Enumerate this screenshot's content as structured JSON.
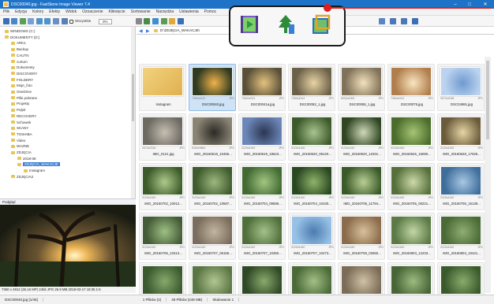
{
  "window": {
    "title": "DSC00040.jpg - FastStone Image Viewer 7.4",
    "min": "–",
    "max": "□",
    "close": "✕"
  },
  "menu": [
    "Plik",
    "Edycja",
    "Kolory",
    "Efekty",
    "Widok",
    "Oznaczenie",
    "Kliknięcie",
    "Sortowanie",
    "Narzędzia",
    "Ustawienia",
    "Pomoc"
  ],
  "toolbar": {
    "fit_label": "Wszystkie",
    "zoom": "0%",
    "sort_select": "Okrzycia & Miniatura",
    "size_select": "Nazwa"
  },
  "callout_icons": [
    "slideshow-film-icon",
    "tree-sort-icon",
    "crop-icon"
  ],
  "tree": [
    {
      "label": "WINDOWS (C:)",
      "depth": 0
    },
    {
      "label": "DOKUMENTY (D:)",
      "depth": 0
    },
    {
      "label": "ARK1",
      "depth": 1
    },
    {
      "label": "Backup",
      "depth": 1
    },
    {
      "label": "CAUTN",
      "depth": 1
    },
    {
      "label": "curtum",
      "depth": 1
    },
    {
      "label": "Dokumenty",
      "depth": 1
    },
    {
      "label": "DISCOVERY",
      "depth": 1
    },
    {
      "label": "FOLDERY",
      "depth": 1
    },
    {
      "label": "Moje_foto",
      "depth": 1
    },
    {
      "label": "OneDrive",
      "depth": 1
    },
    {
      "label": "Pliki pobrane",
      "depth": 1
    },
    {
      "label": "Projekty",
      "depth": 1
    },
    {
      "label": "Pulpit",
      "depth": 1
    },
    {
      "label": "RECOVERY",
      "depth": 1
    },
    {
      "label": "Schowek",
      "depth": 1
    },
    {
      "label": "SKANY",
      "depth": 1
    },
    {
      "label": "TOSHIBA",
      "depth": 1
    },
    {
      "label": "Video",
      "depth": 1
    },
    {
      "label": "WAZNE",
      "depth": 1
    },
    {
      "label": "ZDJĘCIA",
      "depth": 1
    },
    {
      "label": "2018-08",
      "depth": 2
    },
    {
      "label": "ZDJĘCIA_WAKACJE",
      "depth": 2,
      "selected": true
    },
    {
      "label": "Instagram",
      "depth": 3
    },
    {
      "label": "ZDJĘCIA2",
      "depth": 1
    }
  ],
  "preview": {
    "label": "Podgląd",
    "info": "7360 x 4912 (36.15 MP)   24bit   JPG   25.9 MB   2018-03-17 18:35   1:6"
  },
  "address": "D:\\ZDJĘCIA_WAKACJE\\",
  "thumbs": [
    {
      "name": "Instagram",
      "meta_l": "",
      "meta_r": "",
      "folder": true
    },
    {
      "name": "DSC00040.jpg",
      "meta_l": "7360x4912",
      "meta_r": "JPG",
      "selected": true
    },
    {
      "name": "DSC00041a.jpg",
      "meta_l": "7360x4912",
      "meta_r": "JPG"
    },
    {
      "name": "DSC00053_1.jpg",
      "meta_l": "7360x4912",
      "meta_r": "JPG"
    },
    {
      "name": "DSC00058_1.jpg",
      "meta_l": "6000x4000",
      "meta_r": "JPG"
    },
    {
      "name": "DSC00075.jpg",
      "meta_l": "7360x4912",
      "meta_r": "JPG"
    },
    {
      "name": "DSC04981.jpg",
      "meta_l": "3072x2048",
      "meta_r": "JPG"
    },
    {
      "name": "IMG_0121.jpg",
      "meta_l": "3474x2316",
      "meta_r": "JPG"
    },
    {
      "name": "IMG_20160619_10455...",
      "meta_l": "5152x3864",
      "meta_r": "JPG"
    },
    {
      "name": "IMG_20160619_19523...",
      "meta_l": "3120x4160",
      "meta_r": "JPG"
    },
    {
      "name": "IMG_20160620_09120...",
      "meta_l": "3120x4160",
      "meta_r": "JPG"
    },
    {
      "name": "IMG_20160620_12331...",
      "meta_l": "3120x4160",
      "meta_r": "JPG"
    },
    {
      "name": "IMG_20160626_16090...",
      "meta_l": "3120x4160",
      "meta_r": "JPG"
    },
    {
      "name": "IMG_20160628_17025...",
      "meta_l": "3120x4160",
      "meta_r": "JPG"
    },
    {
      "name": "IMG_20160702_10012...",
      "meta_l": "3120x4160",
      "meta_r": "JPG"
    },
    {
      "name": "IMG_20160702_10587...",
      "meta_l": "3120x4160",
      "meta_r": "JPG"
    },
    {
      "name": "IMG_20160704_09586...",
      "meta_l": "3120x4160",
      "meta_r": "JPG"
    },
    {
      "name": "IMG_20160704_10430...",
      "meta_l": "3120x4160",
      "meta_r": "JPG"
    },
    {
      "name": "IMG_20160705_11794...",
      "meta_l": "3120x4160",
      "meta_r": "JPG"
    },
    {
      "name": "IMG_20160705_00221...",
      "meta_l": "3120x4160",
      "meta_r": "JPG"
    },
    {
      "name": "IMG_20160705_15139...",
      "meta_l": "3120x4160",
      "meta_r": "JPG"
    },
    {
      "name": "IMG_20160706_10313...",
      "meta_l": "3120x4160",
      "meta_r": "JPG"
    },
    {
      "name": "IMG_20160707_06155...",
      "meta_l": "3120x4160",
      "meta_r": "JPG"
    },
    {
      "name": "IMG_20160707_10350...",
      "meta_l": "3120x4160",
      "meta_r": "JPG"
    },
    {
      "name": "IMG_20160707_10473...",
      "meta_l": "3120x4160",
      "meta_r": "JPG"
    },
    {
      "name": "IMG_20160708_02550...",
      "meta_l": "3120x4160",
      "meta_r": "JPG"
    },
    {
      "name": "IMG_20160803_12233...",
      "meta_l": "3120x4160",
      "meta_r": "JPG"
    },
    {
      "name": "IMG_20160803_10421...",
      "meta_l": "3120x4160",
      "meta_r": "JPG"
    },
    {
      "name": "",
      "meta_l": "",
      "meta_r": ""
    },
    {
      "name": "",
      "meta_l": "",
      "meta_r": ""
    },
    {
      "name": "",
      "meta_l": "",
      "meta_r": ""
    },
    {
      "name": "",
      "meta_l": "",
      "meta_r": ""
    },
    {
      "name": "",
      "meta_l": "",
      "meta_r": ""
    },
    {
      "name": "",
      "meta_l": "",
      "meta_r": ""
    },
    {
      "name": "",
      "meta_l": "",
      "meta_r": ""
    }
  ],
  "status": {
    "folder": "DSC00040.jpg [1/46]",
    "sel": "1 Plików (2)",
    "size": "48 Plików (248 MB)",
    "zoom": "Skalowanie 1"
  },
  "colors": {
    "title_bar": "#1e73c8",
    "selection": "#3a7fd6",
    "callout_border": "#1a1a1a",
    "red_marker": "#e01c1c"
  }
}
